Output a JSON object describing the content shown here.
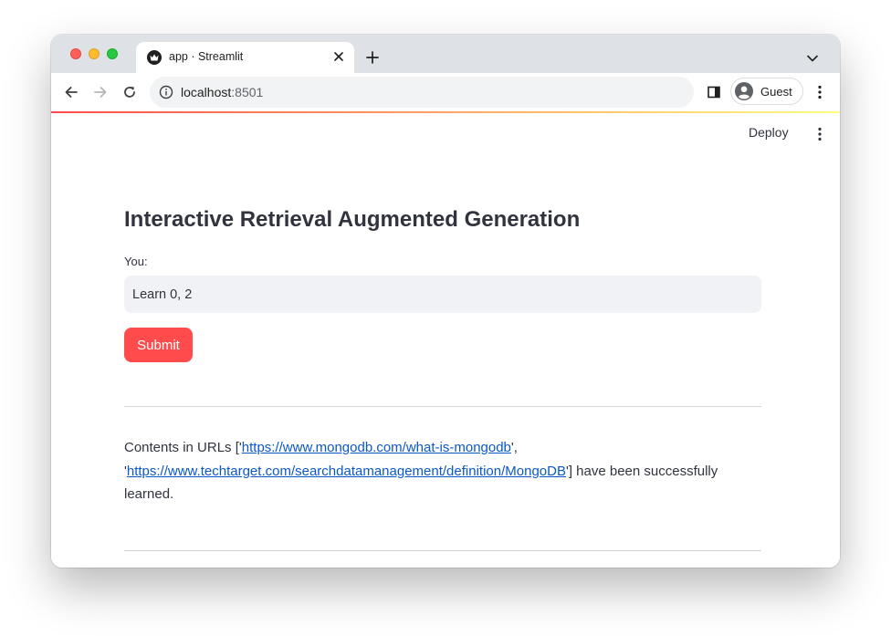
{
  "browser": {
    "tab_title": "app · Streamlit",
    "url_host": "localhost",
    "url_port": ":8501",
    "profile_name": "Guest"
  },
  "header": {
    "deploy_label": "Deploy"
  },
  "main": {
    "title": "Interactive Retrieval Augmented Generation",
    "input_label": "You:",
    "input_value": "Learn 0, 2",
    "submit_label": "Submit",
    "message": {
      "prefix": "Contents in URLs ['",
      "link_1": "https://www.mongodb.com/what-is-mongodb",
      "separator": "', '",
      "link_2": "https://www.techtarget.com/searchdatamanagement/definition/MongoDB",
      "suffix": "'] have been successfully learned."
    }
  },
  "colors": {
    "accent": "#ff4b4b",
    "link": "#0b58c9",
    "input_background": "#f0f2f6",
    "text": "#31333f"
  }
}
